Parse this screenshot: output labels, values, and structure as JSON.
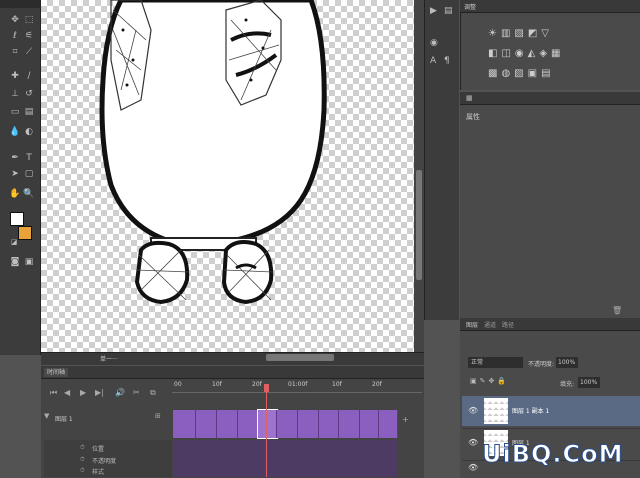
{
  "colors": {
    "app_bg": "#535353",
    "panel_bg": "#4a4a4a",
    "dark_panel": "#3c3c3c",
    "timeline_clip": "#8b5fbf",
    "playhead": "#e06060",
    "foreground_swatch": "#ffffff",
    "background_swatch": "#e8a23a"
  },
  "tools": [
    "move-icon",
    "marquee-icon",
    "lasso-icon",
    "wand-icon",
    "crop-icon",
    "eyedropper-icon",
    "heal-icon",
    "brush-icon",
    "stamp-icon",
    "history-brush-icon",
    "eraser-icon",
    "gradient-icon",
    "blur-icon",
    "dodge-icon",
    "pen-icon",
    "type-icon",
    "path-select-icon",
    "shape-icon",
    "hand-icon",
    "zoom-icon"
  ],
  "canvas": {
    "tab_label": "单一···"
  },
  "adjustments": {
    "tab": "调整"
  },
  "properties": {
    "label": "属性"
  },
  "layers": {
    "tabs": [
      "图层",
      "通道",
      "路径"
    ],
    "blend_mode": "正常",
    "opacity_label": "不透明度:",
    "opacity_value": "100%",
    "fill_label": "填充:",
    "fill_value": "100%",
    "rows": [
      {
        "name": "图层 1 副本 1"
      },
      {
        "name": "图层 1"
      }
    ]
  },
  "timeline": {
    "tab": "时间轴",
    "ruler_labels": [
      "00",
      "10f",
      "20f",
      "01:00f",
      "10f",
      "20f"
    ],
    "track_label": "图层 1",
    "sublabels": [
      "位置",
      "不透明度",
      "样式"
    ]
  },
  "watermark": "UiBQ.CoM"
}
